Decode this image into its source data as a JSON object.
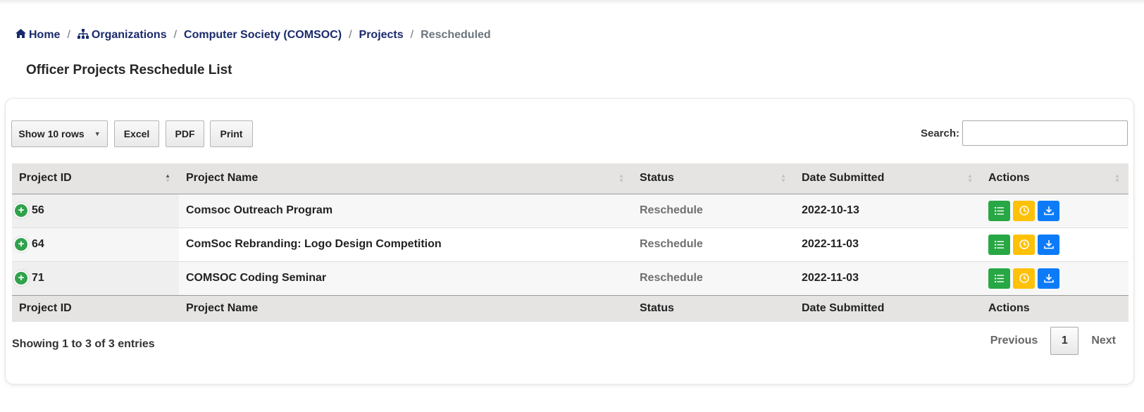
{
  "breadcrumb": {
    "home": "Home",
    "organizations": "Organizations",
    "org": "Computer Society (COMSOC)",
    "projects": "Projects",
    "current": "Rescheduled",
    "separator": "/"
  },
  "page": {
    "title": "Officer Projects Reschedule List"
  },
  "toolbar": {
    "rows_label": "Show 10 rows",
    "rows_caret": "▼",
    "excel": "Excel",
    "pdf": "PDF",
    "print": "Print",
    "search_label": "Search:",
    "search_value": ""
  },
  "table": {
    "headers": [
      "Project ID",
      "Project Name",
      "Status",
      "Date Submitted",
      "Actions"
    ],
    "rows": [
      {
        "id": "56",
        "name": "Comsoc Outreach Program",
        "status": "Reschedule",
        "date": "2022-10-13"
      },
      {
        "id": "64",
        "name": "ComSoc Rebranding: Logo Design Competition",
        "status": "Reschedule",
        "date": "2022-11-03"
      },
      {
        "id": "71",
        "name": "COMSOC Coding Seminar",
        "status": "Reschedule",
        "date": "2022-11-03"
      }
    ],
    "expander_symbol": "+",
    "action_icons": [
      "list-icon",
      "clock-icon",
      "download-icon"
    ]
  },
  "footer": {
    "info": "Showing 1 to 3 of 3 entries",
    "previous": "Previous",
    "page": "1",
    "next": "Next"
  },
  "colors": {
    "link": "#1a2a6c",
    "header_bg": "#e5e4e3",
    "green": "#28a745",
    "yellow": "#ffc107",
    "blue": "#0d7bf7"
  }
}
